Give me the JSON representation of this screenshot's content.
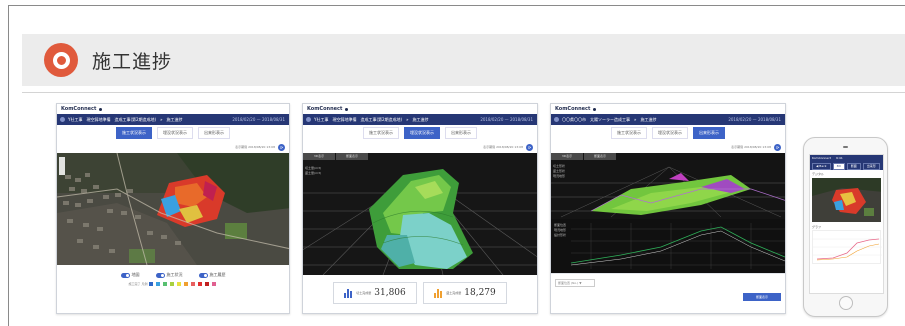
{
  "section": {
    "title": "施工進捗",
    "icon": "target-ring-icon",
    "accent": "#e05a3c"
  },
  "windows": [
    {
      "brand": "KomConnect",
      "nav_text": "Y社工事　現空鋳地準備　造成工事(第2期造成地)　»　施工進捗",
      "nav_right": "2018/02/20 — 2018/08/31",
      "tabs": [
        "施工状況表示",
        "埋没状況表示",
        "出来形表示"
      ],
      "active_tab": 0,
      "toolbar_text": "表示期間 2018/08/20 13:08",
      "legend_toggles": [
        "地図",
        "施工状況",
        "施工履歴"
      ],
      "legend_label": "施工完了 凡例",
      "legend_colors": [
        "#2e67c9",
        "#3aa0e0",
        "#58c070",
        "#a8d040",
        "#e8e040",
        "#f0a030",
        "#e86060",
        "#e03030",
        "#c02020",
        "#e06090"
      ]
    },
    {
      "brand": "KomConnect",
      "nav_text": "Y社工事　現空鋳地準備　造成工事(第2期造成地)　»　施工進捗",
      "nav_right": "2018/02/20 — 2018/08/31",
      "tabs": [
        "施工状況表示",
        "埋没状況表示",
        "出来形表示"
      ],
      "active_tab": 1,
      "toolbar_text": "表示期間 2018/08/20 13:08",
      "subtabs": [
        "3D表示",
        "断面表示"
      ],
      "side_labels": [
        "切土量(m3)",
        "盛土量(m3)"
      ],
      "stats": [
        {
          "label": "切土完成量",
          "value": "31,806",
          "color": "#3d63c7"
        },
        {
          "label": "盛土完成量",
          "value": "18,279",
          "color": "#f0a030"
        }
      ]
    },
    {
      "brand": "KomConnect",
      "nav_text": "〇〇県〇〇市　太陽ソーラー造成工事　»　施工進捗",
      "nav_right": "2018/02/20 — 2018/08/31",
      "tabs": [
        "施工状況表示",
        "埋没状況表示",
        "出来形表示"
      ],
      "active_tab": 2,
      "toolbar_text": "表示期間 2018/08/20 13:08",
      "subtabs": [
        "3D表示",
        "断面表示"
      ],
      "side_labels": [
        "切土形状",
        "盛土形状",
        "現況地形"
      ],
      "section_labels": [
        "断面位置",
        "現況地形",
        "設計形状"
      ],
      "input_placeholder": "断面位置 (No.) ▼",
      "go_label": "断面表示"
    }
  ],
  "phone": {
    "status_left": "KomConnect",
    "status_right": "9:41",
    "nav_items": [
      "◀ Back",
      "3D",
      "断面",
      "出来形"
    ],
    "active_nav": 1,
    "title": "デジタル",
    "chart_title": "グラフ"
  }
}
